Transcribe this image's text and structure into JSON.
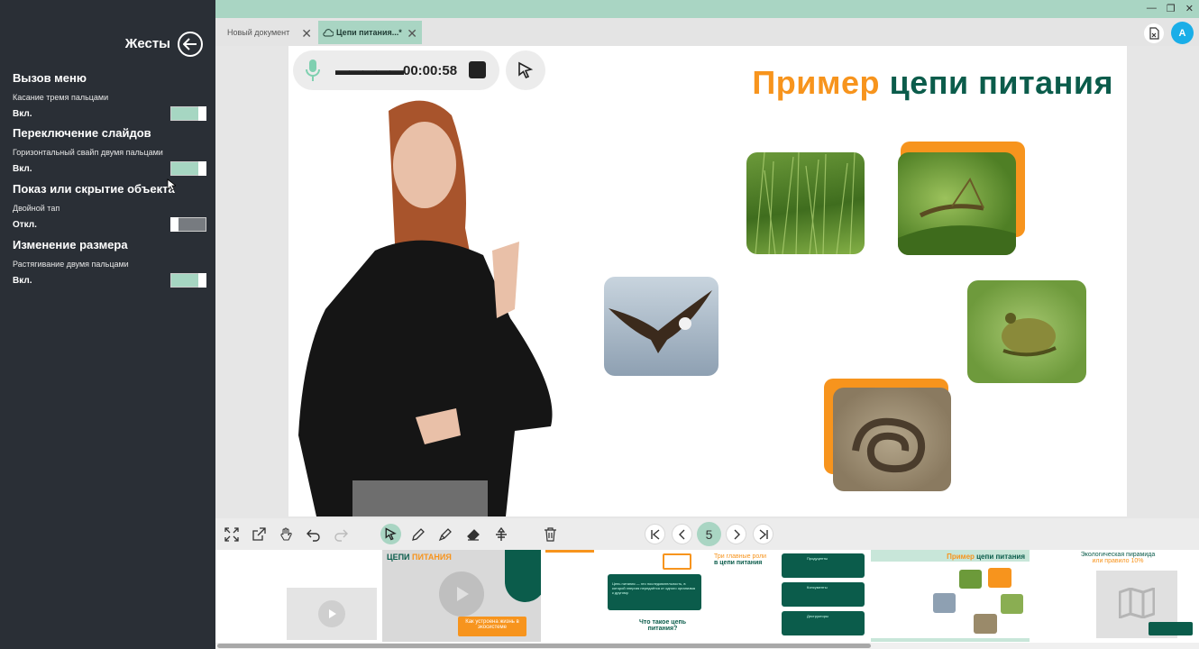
{
  "panel": {
    "title": "Жесты",
    "gestures": [
      {
        "title": "Вызов меню",
        "desc": "Касание тремя пальцами",
        "state": "Вкл.",
        "on": true
      },
      {
        "title": "Переключение слайдов",
        "desc": "Горизонтальный свайп двумя пальцами",
        "state": "Вкл.",
        "on": true
      },
      {
        "title": "Показ или скрытие объекта",
        "desc": "Двойной тап",
        "state": "Откл.",
        "on": false
      },
      {
        "title": "Изменение размера",
        "desc": "Растягивание двумя пальцами",
        "state": "Вкл.",
        "on": true
      }
    ]
  },
  "tabs": [
    {
      "label": "Новый документ",
      "active": false
    },
    {
      "label": "Цепи питания...*",
      "active": true
    }
  ],
  "user": {
    "avatar_letter": "A"
  },
  "recorder": {
    "time": "00:00:58",
    "wave": "▬▬▬▬▬"
  },
  "slide": {
    "title_part1": "Пример",
    "title_part2": "цепи питания"
  },
  "toolbar": {
    "page": "5"
  },
  "thumbs": {
    "t2_title_a": "ЦЕПИ ",
    "t2_title_b": "ПИТАНИЯ",
    "t2_button": "Как устроена жизнь в экосистеме",
    "t3_card": "Цепь питания — это последовательность, в которой энергия передаётся от одного организма к другому.",
    "t3_question": "Что такое цепь питания?",
    "t4_title_a": "Три главные роли",
    "t4_title_b": "в цепи питания",
    "t4_card1": "Продуценты",
    "t4_card2": "Консументы",
    "t4_card3": "Деструкторы",
    "t5_title_a": "Пример ",
    "t5_title_b": "цепи питания",
    "t6_title_a": "Экологическая пирамида",
    "t6_title_b": "или правило 10%"
  },
  "colors": {
    "accent": "#a9d5c3",
    "orange": "#f7941d",
    "dark_green": "#0b5c4b",
    "panel_bg": "#2a2f36"
  }
}
